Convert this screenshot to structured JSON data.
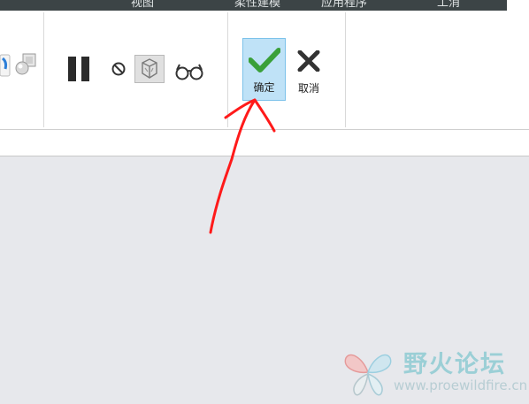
{
  "menu": {
    "items": [
      "视图",
      "柔性建模",
      "应用程序",
      "工消"
    ]
  },
  "toolbar": {
    "ok_label": "确定",
    "cancel_label": "取消"
  },
  "annotation": {
    "color": "#ff1a1a"
  },
  "watermark": {
    "title": "野火论坛",
    "url": "www.proewildfire.cn"
  },
  "colors": {
    "accent_ok_bg": "#bfe2f7",
    "accent_ok_border": "#7cc2ea",
    "check_green": "#3aa03a",
    "canvas_bg": "#e7e8ec"
  }
}
